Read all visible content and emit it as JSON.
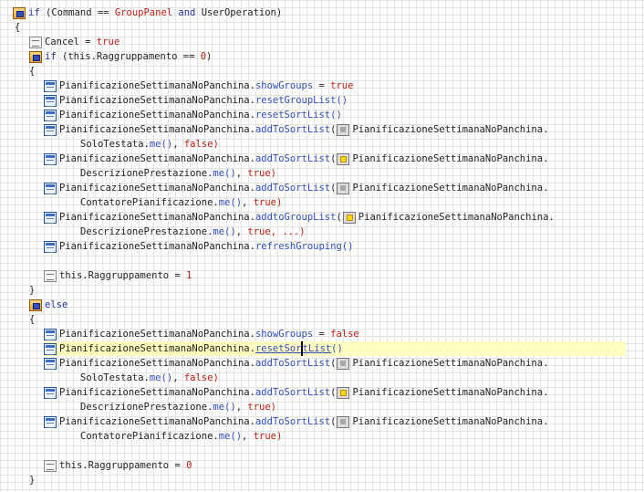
{
  "lines": {
    "if_cond": {
      "kw": "if",
      "open": " (",
      "lhs": "Command",
      "op": " == ",
      "cls": "GroupPanel",
      "and": " and ",
      "rhs": "UserOperation",
      "close": ")"
    },
    "brace_open_1": "{",
    "cancel": {
      "lhs": "Cancel",
      "op": " = ",
      "val": "true"
    },
    "if_inner": {
      "kw": "if",
      "open": " (",
      "expr": "this.Raggruppamento",
      "op": " == ",
      "num": "0",
      "close": ")"
    },
    "brace_open_2": "{",
    "show_groups": {
      "obj": "PianificazioneSettimanaNoPanchina",
      "dot": ".",
      "member": "showGroups",
      "op": " = ",
      "val": "true"
    },
    "reset_group": {
      "obj": "PianificazioneSettimanaNoPanchina",
      "dot": ".",
      "member": "resetGroupList",
      "args": "()"
    },
    "reset_sort": {
      "obj": "PianificazioneSettimanaNoPanchina",
      "dot": ".",
      "member": "resetSortList",
      "args": "()"
    },
    "add_sort_1": {
      "obj": "PianificazioneSettimanaNoPanchina",
      "dot": ".",
      "member": "addToSortList",
      "open": "(",
      "param_obj": "PianificazioneSettimanaNoPanchina."
    },
    "add_sort_1_cont": {
      "field": "SoloTestata",
      "dot": ".",
      "me": "me",
      "paren": "()",
      "sep": ", ",
      "val": "false",
      "close": ")"
    },
    "add_sort_2": {
      "obj": "PianificazioneSettimanaNoPanchina",
      "dot": ".",
      "member": "addToSortList",
      "open": "(",
      "param_obj": "PianificazioneSettimanaNoPanchina."
    },
    "add_sort_2_cont": {
      "field": "DescrizionePrestazione",
      "dot": ".",
      "me": "me",
      "paren": "()",
      "sep": ", ",
      "val": "true",
      "close": ")"
    },
    "add_sort_3": {
      "obj": "PianificazioneSettimanaNoPanchina",
      "dot": ".",
      "member": "addToSortList",
      "open": "(",
      "param_obj": "PianificazioneSettimanaNoPanchina."
    },
    "add_sort_3_cont": {
      "field": "ContatorePianificazione",
      "dot": ".",
      "me": "me",
      "paren": "()",
      "sep": ", ",
      "val": "true",
      "close": ")"
    },
    "add_group": {
      "obj": "PianificazioneSettimanaNoPanchina",
      "dot": ".",
      "member": "addtoGroupList",
      "open": "(",
      "param_obj": "PianificazioneSettimanaNoPanchina."
    },
    "add_group_cont": {
      "field": "DescrizionePrestazione",
      "dot": ".",
      "me": "me",
      "paren": "()",
      "sep": ", ",
      "val": "true",
      "rest": ", ...)"
    },
    "refresh": {
      "obj": "PianificazioneSettimanaNoPanchina",
      "dot": ".",
      "member": "refreshGrouping",
      "args": "()"
    },
    "assign_1": {
      "lhs": "this.Raggruppamento",
      "op": " = ",
      "num": "1"
    },
    "brace_close_2": "}",
    "else": "else",
    "brace_open_3": "{",
    "show_groups_2": {
      "obj": "PianificazioneSettimanaNoPanchina",
      "dot": ".",
      "member": "showGroups",
      "op": " = ",
      "val": "false"
    },
    "reset_sort_2": {
      "obj": "PianificazioneSettimanaNoPanchina",
      "dot": ".",
      "member_a": "resetSor",
      "member_b": "tList",
      "args": "()"
    },
    "add_sort_4": {
      "obj": "PianificazioneSettimanaNoPanchina",
      "dot": ".",
      "member": "addToSortList",
      "open": "(",
      "param_obj": "PianificazioneSettimanaNoPanchina."
    },
    "add_sort_4_cont": {
      "field": "SoloTestata",
      "dot": ".",
      "me": "me",
      "paren": "()",
      "sep": ", ",
      "val": "false",
      "close": ")"
    },
    "add_sort_5": {
      "obj": "PianificazioneSettimanaNoPanchina",
      "dot": ".",
      "member": "addToSortList",
      "open": "(",
      "param_obj": "PianificazioneSettimanaNoPanchina."
    },
    "add_sort_5_cont": {
      "field": "DescrizionePrestazione",
      "dot": ".",
      "me": "me",
      "paren": "()",
      "sep": ", ",
      "val": "true",
      "close": ")"
    },
    "add_sort_6": {
      "obj": "PianificazioneSettimanaNoPanchina",
      "dot": ".",
      "member": "addToSortList",
      "open": "(",
      "param_obj": "PianificazioneSettimanaNoPanchina."
    },
    "add_sort_6_cont": {
      "field": "ContatorePianificazione",
      "dot": ".",
      "me": "me",
      "paren": "()",
      "sep": ", ",
      "val": "true",
      "close": ")"
    },
    "assign_0": {
      "lhs": "this.Raggruppamento",
      "op": " = ",
      "num": "0"
    },
    "brace_close_3": "}"
  },
  "icons": {
    "if_block": "if-block-icon",
    "statement": "statement-icon",
    "method_call": "method-call-icon",
    "param_gray": "parameter-field-icon",
    "param_yellow": "parameter-value-icon"
  },
  "colors": {
    "keyword": "#1a30a0",
    "literal": "#c02010",
    "member": "#3050c0",
    "highlight": "#ffffc0"
  }
}
